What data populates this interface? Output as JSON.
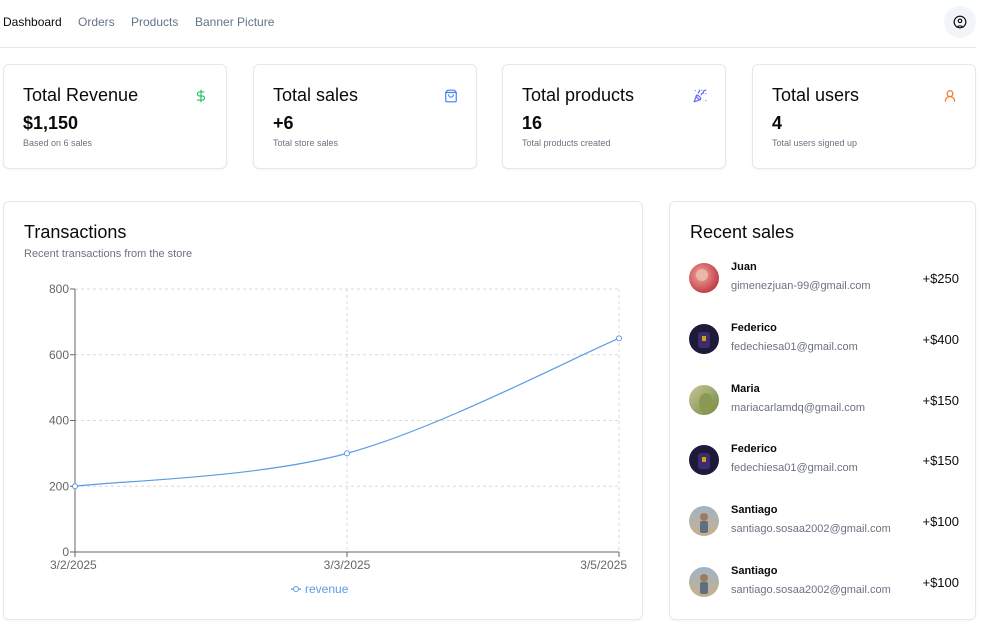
{
  "nav": {
    "links": [
      "Dashboard",
      "Orders",
      "Products",
      "Banner Picture"
    ],
    "user_icon": "user-circle-icon"
  },
  "stats": [
    {
      "title": "Total Revenue",
      "value": "$1,150",
      "sub": "Based on 6 sales",
      "icon": "dollar-icon",
      "color": "#22c55e"
    },
    {
      "title": "Total sales",
      "value": "+6",
      "sub": "Total store sales",
      "icon": "shopping-bag-icon",
      "color": "#3b82f6"
    },
    {
      "title": "Total products",
      "value": "16",
      "sub": "Total products created",
      "icon": "party-popper-icon",
      "color": "#6366f1"
    },
    {
      "title": "Total users",
      "value": "4",
      "sub": "Total users signed up",
      "icon": "user-icon",
      "color": "#f97316"
    }
  ],
  "transactions": {
    "title": "Transactions",
    "subtitle": "Recent transactions from the store"
  },
  "chart_data": {
    "type": "line",
    "x": [
      "3/2/2025",
      "3/3/2025",
      "3/5/2025"
    ],
    "series": [
      {
        "name": "revenue",
        "values": [
          200,
          300,
          650
        ],
        "color": "#5b9be6"
      }
    ],
    "yticks": [
      0,
      200,
      400,
      600,
      800
    ],
    "ylim": [
      0,
      800
    ],
    "grid": true,
    "legend": "bottom"
  },
  "recent_sales": {
    "title": "Recent sales",
    "items": [
      {
        "name": "Juan",
        "email": "gimenezjuan-99@gmail.com",
        "amount": "+$250"
      },
      {
        "name": "Federico",
        "email": "fedechiesa01@gmail.com",
        "amount": "+$400"
      },
      {
        "name": "Maria",
        "email": "mariacarlamdq@gmail.com",
        "amount": "+$150"
      },
      {
        "name": "Federico",
        "email": "fedechiesa01@gmail.com",
        "amount": "+$150"
      },
      {
        "name": "Santiago",
        "email": "santiago.sosaa2002@gmail.com",
        "amount": "+$100"
      },
      {
        "name": "Santiago",
        "email": "santiago.sosaa2002@gmail.com",
        "amount": "+$100"
      }
    ]
  }
}
